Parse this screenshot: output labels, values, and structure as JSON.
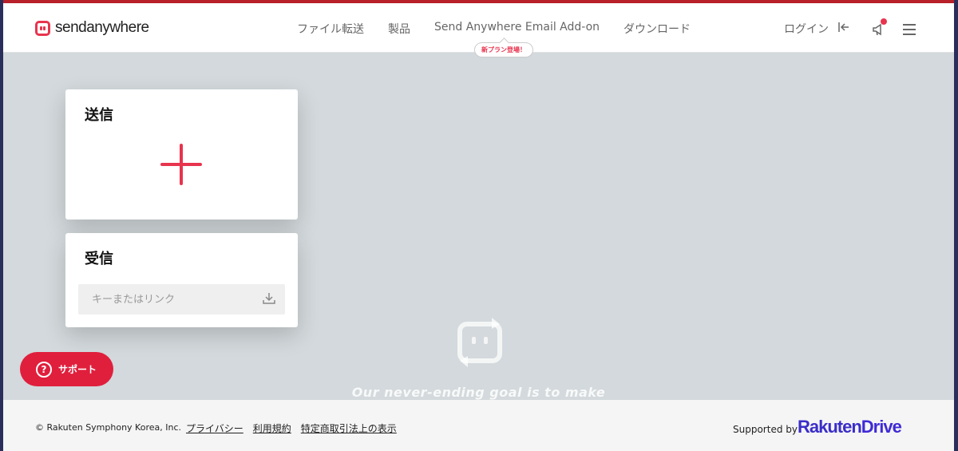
{
  "header": {
    "logo_text": "sendanywhere",
    "nav": [
      {
        "label": "ファイル転送"
      },
      {
        "label": "製品"
      },
      {
        "label": "Send Anywhere Email Add-on"
      },
      {
        "label": "ダウンロード"
      }
    ],
    "new_plan_badge": "新プラン登場！",
    "login_label": "ログイン"
  },
  "send_card": {
    "title": "送信"
  },
  "receive_card": {
    "title": "受信",
    "key_placeholder": "キーまたはリンク"
  },
  "support_button": {
    "label": "サポート",
    "icon_glyph": "?"
  },
  "tagline": "Our never-ending goal is to make",
  "footer": {
    "copyright": "© Rakuten Symphony Korea, Inc.",
    "links": [
      "プライバシー",
      "利用規約",
      "特定商取引法上の表示"
    ],
    "supported_by": "Supported by",
    "brand_part1": "Rakuten",
    "brand_part2": "Drive"
  },
  "colors": {
    "accent": "#e8344e",
    "support_bg": "#e01f3d",
    "brand": "#3a2ec8"
  }
}
